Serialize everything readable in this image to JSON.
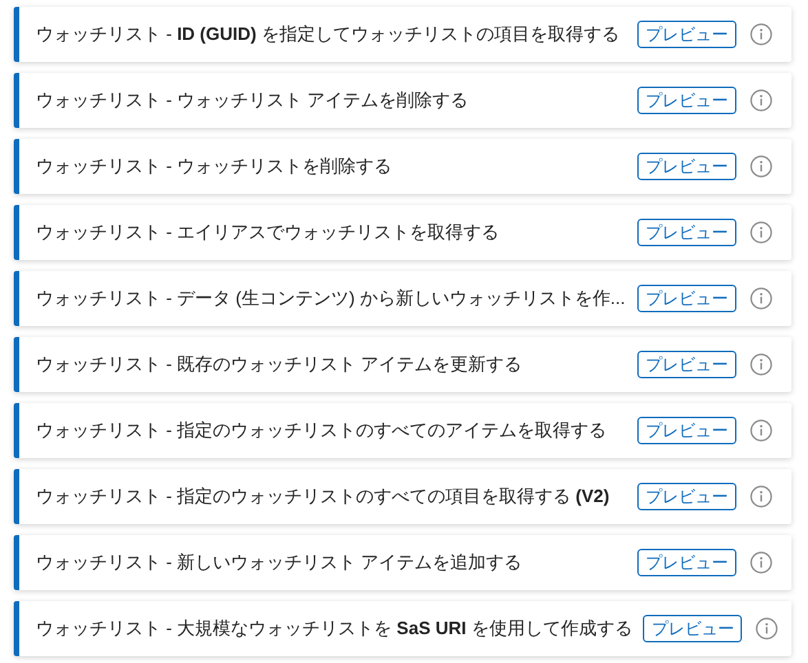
{
  "items": [
    {
      "title": "ウォッチリスト - **ID (GUID)** を指定してウォッチリストの項目を取得する",
      "badge": "プレビュー"
    },
    {
      "title": "ウォッチリスト - ウォッチリスト アイテムを削除する",
      "badge": "プレビュー"
    },
    {
      "title": "ウォッチリスト - ウォッチリストを削除する",
      "badge": "プレビュー"
    },
    {
      "title": "ウォッチリスト - エイリアスでウォッチリストを取得する",
      "badge": "プレビュー"
    },
    {
      "title": "ウォッチリスト - データ (生コンテンツ) から新しいウォッチリストを作...",
      "badge": "プレビュー"
    },
    {
      "title": "ウォッチリスト - 既存のウォッチリスト アイテムを更新する",
      "badge": "プレビュー"
    },
    {
      "title": "ウォッチリスト - 指定のウォッチリストのすべてのアイテムを取得する",
      "badge": "プレビュー"
    },
    {
      "title": "ウォッチリスト - 指定のウォッチリストのすべての項目を取得する **(V2)**",
      "badge": "プレビュー"
    },
    {
      "title": "ウォッチリスト - 新しいウォッチリスト アイテムを追加する",
      "badge": "プレビュー"
    },
    {
      "title": "ウォッチリスト - 大規模なウォッチリストを **SaS URI** を使用して作成する",
      "badge": "プレビュー"
    }
  ]
}
